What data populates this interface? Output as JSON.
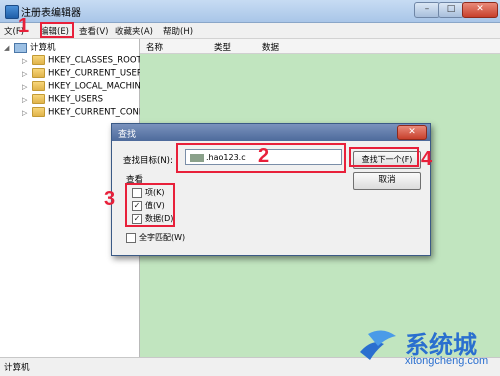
{
  "window": {
    "title": "注册表编辑器",
    "controls": {
      "min": "–",
      "max": "□",
      "close": "✕"
    }
  },
  "menu": [
    "文(F)",
    "编辑(E)",
    "查看(V)",
    "收藏夹(A)",
    "帮助(H)"
  ],
  "tree": {
    "root": "计算机",
    "items": [
      "HKEY_CLASSES_ROOT",
      "HKEY_CURRENT_USER",
      "HKEY_LOCAL_MACHINE",
      "HKEY_USERS",
      "HKEY_CURRENT_CONFIG"
    ]
  },
  "list": {
    "columns": [
      "名称",
      "类型",
      "数据"
    ]
  },
  "status": {
    "text": "计算机"
  },
  "dialog": {
    "title": "查找",
    "find_label": "查找目标(N):",
    "find_value": ".hao123.c",
    "find_next": "查找下一个(F)",
    "cancel": "取消",
    "look_at": "查看",
    "options": [
      {
        "label": "项(K)",
        "checked": false
      },
      {
        "label": "值(V)",
        "checked": true
      },
      {
        "label": "数据(D)",
        "checked": true
      }
    ],
    "match_whole": "全字匹配(W)",
    "match_whole_checked": false
  },
  "annotations": {
    "n1": "1",
    "n2": "2",
    "n3": "3",
    "n4": "4",
    "color": "#e8203a"
  },
  "watermark": {
    "text": "系统城",
    "url": "xitongcheng.com"
  }
}
